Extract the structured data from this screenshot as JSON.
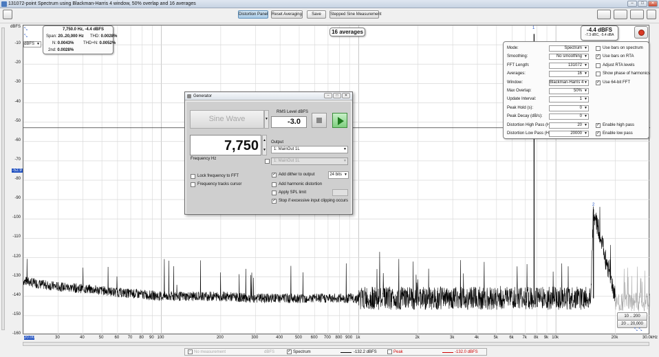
{
  "window": {
    "title": "131072-point Spectrum using Blackman-Harris 4 window, 50% overlap and 16 averages",
    "controls": [
      "–",
      "□",
      "✕"
    ]
  },
  "toolbar": {
    "distortion_panel": "Distortion Panel",
    "reset_averaging": "Reset Averaging",
    "save": "Save",
    "stepped_sine": "Stepped Sine Measurement"
  },
  "readout": {
    "headline": "7,750.0 Hz, -4.4 dBFS",
    "span_label": "Span:",
    "span_value": "20..20,000 Hz",
    "thd_label": "THD:",
    "thd_value": "0.0028%",
    "n_label": "N:",
    "n_value": "0.0043%",
    "thdn_label": "THD+N:",
    "thdn_value": "0.0052%",
    "second_label": "2nd:",
    "second_value": "0.0028%",
    "unit_select": "dBFS"
  },
  "averages_badge": "16 averages",
  "level": {
    "big": "-4.4 dBFS",
    "small": "-7.3 dBC, -5.4 dBA"
  },
  "markers": {
    "m1": "1",
    "m2": "2"
  },
  "cursor_value": "-52.9",
  "y_axis": {
    "title": "dBFS",
    "ticks": [
      "-10",
      "-20",
      "-30",
      "-40",
      "-50",
      "-60",
      "-70",
      "-80",
      "-90",
      "-100",
      "-110",
      "-120",
      "-130",
      "-140",
      "-150",
      "-160"
    ]
  },
  "x_axis": {
    "ticks": [
      "20.00",
      "30",
      "40",
      "50",
      "60",
      "70",
      "80",
      "90",
      "100",
      "200",
      "300",
      "400",
      "500",
      "600",
      "700",
      "800",
      "900",
      "1k",
      "2k",
      "3k",
      "4k",
      "5k",
      "6k",
      "7k",
      "8k",
      "9k",
      "10k",
      "20k",
      "30.0kHz"
    ]
  },
  "settings": {
    "rows": [
      {
        "label": "Mode:",
        "value": "Spectrum"
      },
      {
        "label": "Smoothing:",
        "value": "No smoothing"
      },
      {
        "label": "FFT Length:",
        "value": "131072"
      },
      {
        "label": "Averages:",
        "value": "16"
      },
      {
        "label": "Window:",
        "value": "Blackman-Harris 4"
      },
      {
        "label": "Max Overlap:",
        "value": "50%"
      },
      {
        "label": "Update Interval:",
        "value": "1"
      },
      {
        "label": "Peak Hold (s):",
        "value": "0"
      },
      {
        "label": "Peak Decay (dB/s):",
        "value": "0"
      },
      {
        "label": "Distortion High Pass (Hz):",
        "value": "20"
      },
      {
        "label": "Distortion Low Pass (Hz):",
        "value": "20000"
      }
    ],
    "checks": [
      {
        "label": "Use bars on spectrum",
        "checked": false
      },
      {
        "label": "Use bars on RTA",
        "checked": true
      },
      {
        "label": "Adjust RTA levels",
        "checked": false
      },
      {
        "label": "Show phase of harmonics",
        "checked": false
      },
      {
        "label": "Use 64-bit FFT",
        "checked": true
      },
      {
        "label": "Enable high pass",
        "checked": true
      },
      {
        "label": "Enable low pass",
        "checked": true
      }
    ]
  },
  "generator": {
    "title": "Generator",
    "wave": "Sine Wave",
    "rms_label": "RMS Level dBFS",
    "rms_value": "-3.0",
    "freq_value": "7,750",
    "freq_label": "Frequency Hz",
    "output_label": "Output",
    "output_value": "1: MainOut 1L",
    "output2_value": "1: MainOut 1L",
    "lock_fft": "Lock frequency to FFT",
    "tracks_cursor": "Frequency tracks cursor",
    "add_dither": "Add dither to output",
    "dither_bits": "24 bits",
    "add_harmonic": "Add harmonic distortion",
    "apply_spl": "Apply SPL limit",
    "stop_clipping": "Stop if excessive input clipping occurs"
  },
  "range_buttons": {
    "r1": "10 .. 200",
    "r2": "20 .. 20,000"
  },
  "legend": {
    "no_measurement": "No measurement",
    "unit1": "dBFS",
    "spectrum": "Spectrum",
    "spectrum_value": "-132.2 dBFS",
    "peak": "Peak",
    "peak_value": "-132.0 dBFS"
  },
  "colors": {
    "plot_bg": "#ffffff",
    "trace": "#000000",
    "grid": "#d8d8d8",
    "accent_blue": "#2050c0",
    "peak_red": "#cc0000"
  },
  "chart_data": {
    "type": "line",
    "xscale": "log",
    "xlim": [
      20,
      30000
    ],
    "ylim": [
      -160,
      0
    ],
    "ylabel": "dBFS",
    "series": [
      {
        "name": "Spectrum",
        "x": [
          20,
          25,
          30,
          40,
          50,
          60,
          80,
          100,
          150,
          200,
          300,
          400,
          500,
          600,
          700,
          800,
          1000,
          2000,
          3000,
          4000,
          5000,
          6000,
          7000,
          7500,
          7750,
          8000,
          9000,
          10000,
          15000,
          15500,
          20000
        ],
        "y": [
          -132,
          -134,
          -135,
          -136,
          -137,
          -138,
          -139,
          -140,
          -140,
          -140,
          -141,
          -141,
          -141,
          -141,
          -141,
          -141,
          -141,
          -141,
          -141,
          -141,
          -141,
          -141,
          -141,
          -141,
          -4.4,
          -140,
          -141,
          -141,
          -141,
          -95,
          -141
        ]
      }
    ]
  }
}
